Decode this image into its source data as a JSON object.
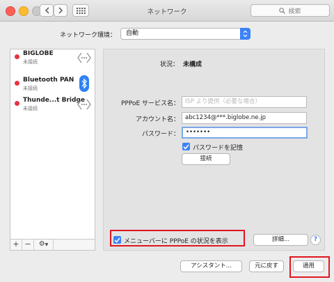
{
  "window": {
    "title": "ネットワーク"
  },
  "toolbar": {
    "back": "back-icon",
    "forward": "forward-icon",
    "grid": "grid-icon",
    "search_placeholder": "検索"
  },
  "location": {
    "label": "ネットワーク環境：",
    "value": "自動"
  },
  "services": [
    {
      "name": "BIGLOBE",
      "status": "未接続",
      "icon": "pppoe-icon"
    },
    {
      "name": "Bluetooth PAN",
      "status": "未接続",
      "icon": "bluetooth-icon"
    },
    {
      "name": "Thunde...t Bridge",
      "status": "未接続",
      "icon": "ethernet-icon"
    }
  ],
  "sidebar_controls": {
    "add": "+",
    "remove": "−",
    "gear": "⚙"
  },
  "detail": {
    "status_label": "状況：",
    "status_value": "未構成",
    "pppoe_label": "PPPoE サービス名：",
    "pppoe_placeholder": "ISP より提供（必要な場合）",
    "account_label": "アカウント名：",
    "account_value": "abc1234@***.biglobe.ne.jp",
    "password_label": "パスワード：",
    "password_value": "•••••••",
    "remember_label": "パスワードを記憶",
    "connect_label": "接続",
    "menubar_label": "メニューバーに PPPoE の状況を表示",
    "advanced_label": "詳細...",
    "help_label": "?"
  },
  "footer": {
    "assistant": "アシスタント...",
    "revert": "元に戻す",
    "apply": "適用"
  },
  "colors": {
    "accent": "#3b82f7",
    "disconnected": "#e5343f",
    "highlight": "#e0161e"
  }
}
